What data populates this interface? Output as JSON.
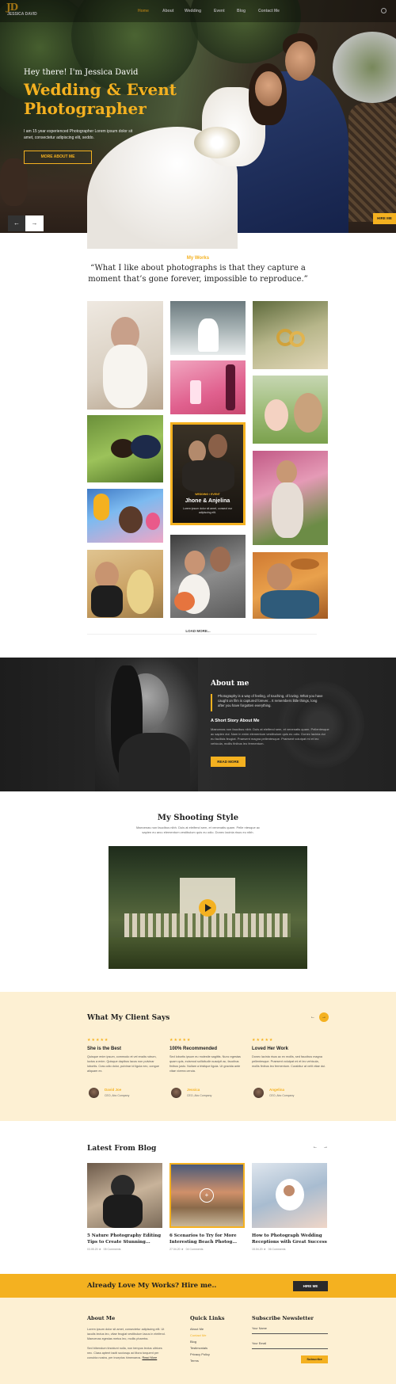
{
  "brand": {
    "mark": "JD",
    "name": "JESSICA DAVID"
  },
  "nav": {
    "items": [
      "Home",
      "About",
      "Wedding",
      "Event",
      "Blog",
      "Contact Me"
    ]
  },
  "hero": {
    "greeting": "Hey there! I'm Jessica David",
    "title": "Wedding & Event Photographer",
    "description": "I am 15 year experienced Photographer Lorem ipsum dolor sit amet, consectetur adipiscing elit, seddo.",
    "button": "MORE ABOUT ME",
    "prev": "←",
    "next": "→",
    "hire_tab": "HIRE ME"
  },
  "works": {
    "label": "My Works",
    "quote": "“What I like about photographs is that they capture a moment that’s gone forever, impossible to reproduce.”",
    "feature": {
      "tag": "WEDDING / EVENT",
      "title": "Jhone & Anjelina",
      "desc": "Lorem ipsum dolor sit amet, consect eur adipiscing elit."
    },
    "load_more": "LOAD MORE..."
  },
  "about": {
    "title": "About me",
    "intro": "Photography is a way of feeling, of touching, of loving. What you have caught on film is captured forever... It remembers little things, long after you have forgotten everything.",
    "subtitle": "A Short Story About Me",
    "text": "Maecenas non faucibus nibh. Duis at eleifend sem, et venenatis quam. Pellentesque ac sapien dui. Nam in enim elementum vestibulum quis eu odio. Donec lacinia dui eu facilisis feugiat. Praesent magna pellentesque. Praesent volutpat mi et leo vehicula, mollis finibus leo fermentum.",
    "button": "READ MORE"
  },
  "shooting": {
    "title": "My Shooting Style",
    "desc": "Maecenas non faucibus nibh. Duis at eleifend sem, et venenatis quam. Pelle ntesque ac sapien eu arcu elementum vestibulum quis eu odio. Donec lacinia risus eu nibh."
  },
  "testimonials": {
    "title": "What My Client Says",
    "prev": "←",
    "next": "→",
    "stars": "★★★★★",
    "items": [
      {
        "title": "She is the Best",
        "text": "Quisque enim ipsum, commodo et vel enalis rutrum, luctus a enim. Quisque dapibus lacus non pulvinar lobortis. Cras odio dolor, pulvinar id ligula nec, congue aliquam ex.",
        "name": "David Joe",
        "role": "CEO, Abc Company"
      },
      {
        "title": "100% Recommended",
        "text": "Sed lobortis ipsum eu molestie sagittis. Nunc egestas quam quis, euismod sollicitudin suscipit ac, faucibus finibus justo. Nullam a tristique ligula. Ut gravida ante vitae viverra ceruia.",
        "name": "Jessica",
        "role": "CEO, Abc Company"
      },
      {
        "title": "Loved Her Work",
        "text": "Donec lacinia risus ac ex mollis, sed faucibus magna pellentesque. Praesent volutpat mi et leo vehicula, mollis finibus leo fermentum. Curabitur at velit vitae dui.",
        "name": "Angelina",
        "role": "CEO, Abc Company"
      }
    ]
  },
  "blog": {
    "title": "Latest From Blog",
    "prev": "←",
    "next": "→",
    "posts": [
      {
        "title": "5 Nature Photography Editing Tips to Create Stunning...",
        "date": "03.05.20 ★",
        "comments": "05 Comments"
      },
      {
        "title": "6 Scenarios to Try for More Interesting Beach Photog...",
        "date": "27.04.20 ★",
        "comments": "04 Comments"
      },
      {
        "title": "How to Photograph Wedding Receptions with Great Success",
        "date": "15.04.20 ★",
        "comments": "06 Comments"
      }
    ]
  },
  "cta": {
    "text": "Already Love My Works? Hire me..",
    "button": "HIRE ME"
  },
  "footer": {
    "about_title": "About Me",
    "about_text": "Lorem ipsum dolor sit amet, consectetur adipiscing elit. Ut iaculis lectus leo, vitae feugiat vestibulum lacus in eleifend. Maecenas egestas metus leo, mollis pharetra.",
    "about_text2": "Sed bibendum tincidunt nulla, non tempus lectus ultrices nec. Class aptent taciti sociosqu ad litora torquent per conubia nostra, per inceptos himenaeos.",
    "read_more": "Read More",
    "links_title": "Quick Links",
    "links": [
      "About Me",
      "Contact Me",
      "Blog",
      "Testimonials",
      "Privacy Policy",
      "Terms"
    ],
    "newsletter_title": "Subscribe Newsletter",
    "name_label": "Your Name",
    "email_label": "Your Email",
    "subscribe": "Subscribe"
  },
  "colors": {
    "accent": "#f4b120",
    "dark": "#222222",
    "cream": "#fdf0d3"
  }
}
